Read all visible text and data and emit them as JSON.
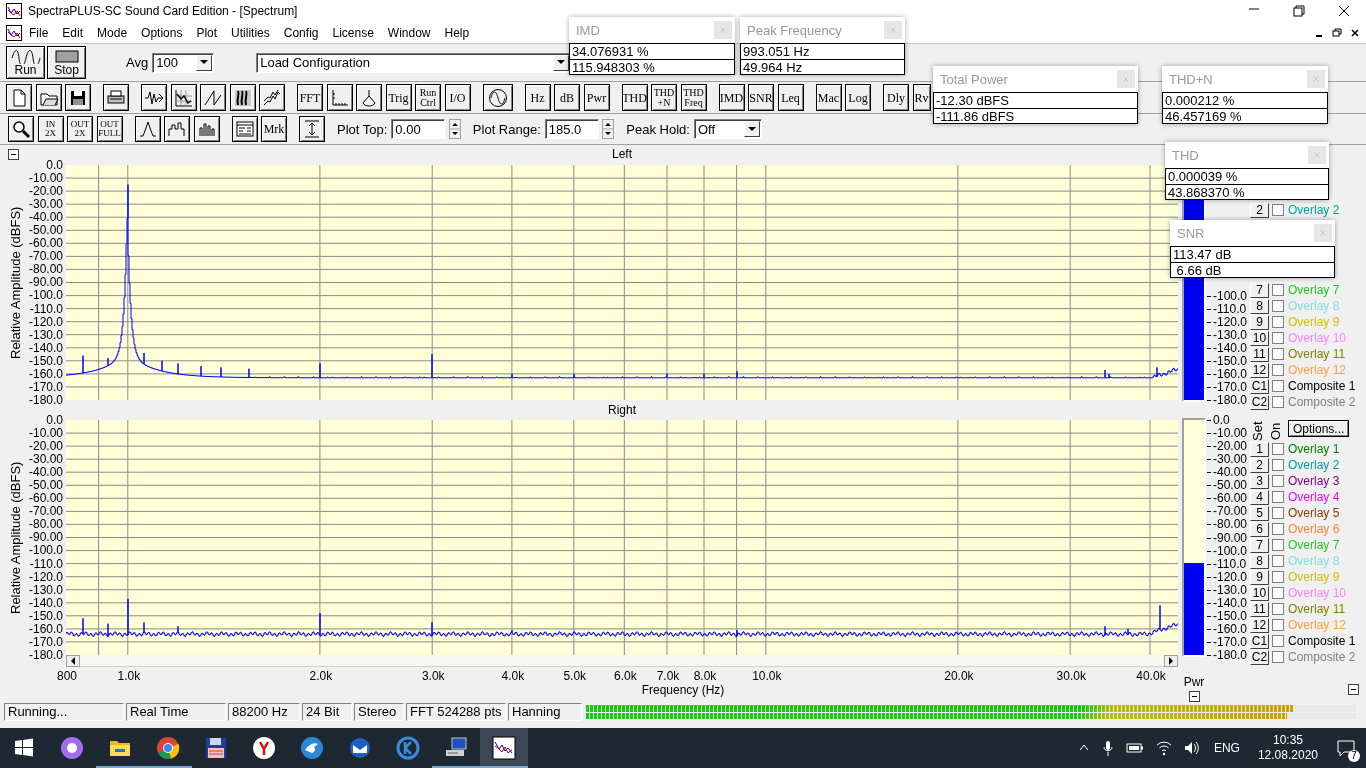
{
  "window": {
    "title": "SpectraPLUS-SC Sound Card Edition - [Spectrum]"
  },
  "menu": [
    "File",
    "Edit",
    "Mode",
    "Options",
    "Plot",
    "Utilities",
    "Config",
    "License",
    "Window",
    "Help"
  ],
  "toolbar_1": {
    "run": "Run",
    "stop": "Stop",
    "avg_label": "Avg",
    "avg_value": "100",
    "configuration": "Load Configuration"
  },
  "toolbar_2": [
    [
      {
        "kind": "new"
      },
      {
        "kind": "open"
      },
      {
        "kind": "save"
      }
    ],
    [
      {
        "kind": "print"
      }
    ],
    [
      {
        "kind": "stream"
      },
      {
        "kind": "xy"
      },
      {
        "kind": "sawtooth"
      },
      {
        "kind": "spectrogram"
      },
      {
        "kind": "waterfall"
      }
    ],
    [
      {
        "kind": "text",
        "label": "FFT"
      },
      {
        "kind": "axis"
      },
      {
        "kind": "scope"
      },
      {
        "kind": "text",
        "label": "Trig"
      },
      {
        "kind": "text",
        "label": "Run\nCtrl"
      },
      {
        "kind": "text",
        "label": "I/O"
      }
    ],
    [
      {
        "kind": "sine"
      }
    ],
    [
      {
        "kind": "text",
        "label": "Hz"
      },
      {
        "kind": "text",
        "label": "dB"
      },
      {
        "kind": "text",
        "label": "Pwr"
      }
    ],
    [
      {
        "kind": "text",
        "label": "THD"
      },
      {
        "kind": "text",
        "label": "THD\n+N"
      },
      {
        "kind": "text",
        "label": "THD\nFreq"
      }
    ],
    [
      {
        "kind": "text",
        "label": "IMD"
      },
      {
        "kind": "text",
        "label": "SNR"
      },
      {
        "kind": "text",
        "label": "Leq"
      }
    ],
    [
      {
        "kind": "text",
        "label": "Mac"
      },
      {
        "kind": "text",
        "label": "Log"
      }
    ],
    [
      {
        "kind": "text",
        "label": "Dly"
      },
      {
        "kind": "text",
        "label": "Rv"
      }
    ]
  ],
  "toolbar_3": {
    "buttons": [
      [
        {
          "kind": "magnifier"
        },
        {
          "kind": "text",
          "label": "IN\n2X"
        },
        {
          "kind": "text",
          "label": "OUT\n2X"
        },
        {
          "kind": "text",
          "label": "OUT\nFULL"
        }
      ],
      [
        {
          "kind": "peak"
        },
        {
          "kind": "steps"
        },
        {
          "kind": "bars"
        }
      ],
      [
        {
          "kind": "panel"
        },
        {
          "kind": "text",
          "label": "Mrk"
        }
      ],
      [
        {
          "kind": "range"
        }
      ]
    ],
    "plot_top": {
      "label": "Plot Top:",
      "value": "0.00"
    },
    "plot_range": {
      "label": "Plot Range:",
      "value": "185.0"
    },
    "peak_hold": {
      "label": "Peak Hold:",
      "value": "Off"
    }
  },
  "plots": [
    {
      "title": "Left",
      "ylabel": "Relative Amplitude (dBFS)",
      "y_labels": [
        "0.0",
        "-10.00",
        "-20.00",
        "-30.00",
        "-40.00",
        "-50.00",
        "-60.00",
        "-70.00",
        "-80.00",
        "-90.00",
        "-100.0",
        "-110.0",
        "-120.0",
        "-130.0",
        "-140.0",
        "-150.0",
        "-160.0",
        "-170.0",
        "-180.0"
      ]
    },
    {
      "title": "Right",
      "ylabel": "Relative Amplitude (dBFS)",
      "y_labels": [
        "0.0",
        "-10.00",
        "-20.00",
        "-30.00",
        "-40.00",
        "-50.00",
        "-60.00",
        "-70.00",
        "-80.00",
        "-90.00",
        "-100.0",
        "-110.0",
        "-120.0",
        "-130.0",
        "-140.0",
        "-150.0",
        "-160.0",
        "-170.0",
        "-180.0"
      ],
      "x_labels": [
        "800",
        "1.0k",
        "2.0k",
        "3.0k",
        "4.0k",
        "5.0k",
        "6.0k",
        "7.0k",
        "8.0k",
        "10.0k",
        "20.0k",
        "30.0k",
        "40.0k"
      ],
      "xlabel": "Frequency (Hz)"
    }
  ],
  "meters": [
    {
      "level": 0.93,
      "labels": [
        "-100.0",
        "-110.0",
        "-120.0",
        "-130.0",
        "-140.0",
        "-150.0",
        "-160.0",
        "-170.0",
        "-180.0"
      ]
    },
    {
      "level": 0.39,
      "labels": [
        "0.0",
        "-10.00",
        "-20.00",
        "-30.00",
        "-40.00",
        "-50.00",
        "-60.00",
        "-70.00",
        "-80.00",
        "-90.00",
        "-100.0",
        "-110.0",
        "-120.0",
        "-130.0",
        "-140.0",
        "-150.0",
        "-160.0",
        "-170.0",
        "-180.0"
      ],
      "caption": "Pwr"
    }
  ],
  "legends": [
    {
      "items": [
        {
          "set": "2",
          "on": false,
          "name": "Overlay 2",
          "color": "#00a0a0"
        },
        {
          "set": "7",
          "on": false,
          "name": "Overlay 7",
          "color": "#20c820"
        },
        {
          "set": "8",
          "on": false,
          "name": "Overlay 8",
          "color": "#80e0e0"
        },
        {
          "set": "9",
          "on": false,
          "name": "Overlay 9",
          "color": "#d0c000"
        },
        {
          "set": "10",
          "on": false,
          "name": "Overlay 10",
          "color": "#ff80ff"
        },
        {
          "set": "11",
          "on": false,
          "name": "Overlay 11",
          "color": "#808000"
        },
        {
          "set": "12",
          "on": false,
          "name": "Overlay 12",
          "color": "#ffa040"
        },
        {
          "set": "C1",
          "on": false,
          "name": "Composite 1",
          "color": "#000000"
        },
        {
          "set": "C2",
          "on": false,
          "name": "Composite 2",
          "color": "#808080"
        }
      ]
    },
    {
      "set_header": "Set",
      "on_header": "On",
      "options": "Options...",
      "items": [
        {
          "set": "1",
          "on": false,
          "name": "Overlay 1",
          "color": "#008000"
        },
        {
          "set": "2",
          "on": false,
          "name": "Overlay 2",
          "color": "#00a0a0"
        },
        {
          "set": "3",
          "on": false,
          "name": "Overlay 3",
          "color": "#800080"
        },
        {
          "set": "4",
          "on": false,
          "name": "Overlay 4",
          "color": "#ff00ff"
        },
        {
          "set": "5",
          "on": false,
          "name": "Overlay 5",
          "color": "#804000"
        },
        {
          "set": "6",
          "on": false,
          "name": "Overlay 6",
          "color": "#ff8040"
        },
        {
          "set": "7",
          "on": false,
          "name": "Overlay 7",
          "color": "#20c820"
        },
        {
          "set": "8",
          "on": false,
          "name": "Overlay 8",
          "color": "#80e0e0"
        },
        {
          "set": "9",
          "on": false,
          "name": "Overlay 9",
          "color": "#d0c000"
        },
        {
          "set": "10",
          "on": false,
          "name": "Overlay 10",
          "color": "#ff80ff"
        },
        {
          "set": "11",
          "on": false,
          "name": "Overlay 11",
          "color": "#808000"
        },
        {
          "set": "12",
          "on": false,
          "name": "Overlay 12",
          "color": "#ffa040"
        },
        {
          "set": "C1",
          "on": false,
          "name": "Composite 1",
          "color": "#000000"
        },
        {
          "set": "C2",
          "on": false,
          "name": "Composite 2",
          "color": "#808080"
        }
      ]
    }
  ],
  "measurement_windows": [
    {
      "title": "IMD",
      "values": [
        "34.076931 %",
        "115.948303 %"
      ]
    },
    {
      "title": "Peak Frequency",
      "values": [
        "993.051 Hz",
        "49.964 Hz"
      ]
    },
    {
      "title": "Total Power",
      "values": [
        "-12.30 dBFS",
        "-111.86 dBFS"
      ]
    },
    {
      "title": "THD+N",
      "values": [
        "0.000212 %",
        "46.457169 %"
      ]
    },
    {
      "title": "THD",
      "values": [
        "0.000039 %",
        "43.868370 %"
      ]
    },
    {
      "title": "SNR",
      "values": [
        "113.47 dB",
        " 6.66 dB"
      ]
    }
  ],
  "status_bar": {
    "cells": [
      "Running...",
      "Real Time",
      "88200 Hz",
      "24 Bit",
      "Stereo",
      "FFT 524288 pts",
      "Hanning"
    ],
    "level_meters": [
      {
        "level": 0.92
      },
      {
        "level": 0.91
      }
    ]
  },
  "taskbar": {
    "apps": [
      {
        "kind": "start",
        "running": false,
        "selected": false
      },
      {
        "kind": "assistant",
        "running": false,
        "selected": false
      },
      {
        "kind": "folder",
        "running": true,
        "selected": false
      },
      {
        "kind": "browser",
        "running": true,
        "selected": false
      },
      {
        "kind": "disk",
        "running": false,
        "selected": false
      },
      {
        "kind": "browser2",
        "running": false,
        "selected": false
      },
      {
        "kind": "messenger",
        "running": false,
        "selected": false
      },
      {
        "kind": "mail",
        "running": false,
        "selected": false
      },
      {
        "kind": "ring",
        "running": false,
        "selected": false
      },
      {
        "kind": "computer",
        "running": true,
        "selected": false
      },
      {
        "kind": "spectrum",
        "running": true,
        "selected": true
      }
    ],
    "language": "ENG",
    "time": "10:35",
    "date": "12.08.2020",
    "notifications": "7"
  }
}
